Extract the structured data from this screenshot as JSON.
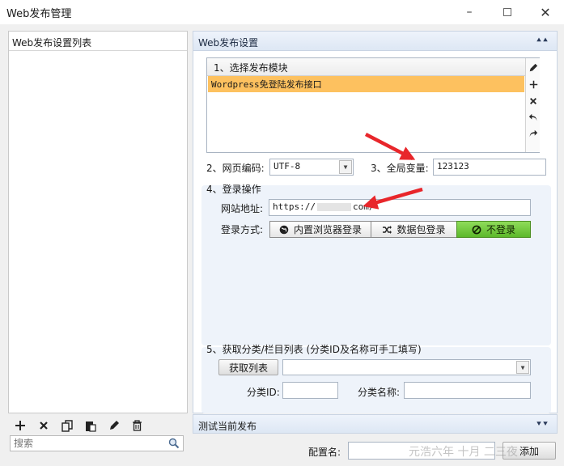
{
  "window": {
    "title": "Web发布管理",
    "minimize_icon": "minimize-icon",
    "maximize_icon": "maximize-icon",
    "close_icon": "close-icon"
  },
  "left_panel": {
    "header": "Web发布设置列表",
    "toolbar_icons": [
      "add-icon",
      "delete-icon",
      "copy-icon",
      "paste-icon",
      "edit-icon",
      "trash-icon"
    ],
    "search_placeholder": "搜索"
  },
  "right_panel": {
    "header": "Web发布设置",
    "module_section": {
      "label": "1、选择发布模块",
      "selected_item": "Wordpress免登陆发布接口",
      "tool_icons": [
        "edit-icon",
        "add-icon",
        "delete-icon",
        "undo-icon",
        "redo-icon"
      ]
    },
    "encoding": {
      "label": "2、网页编码:",
      "value": "UTF-8"
    },
    "global_var": {
      "label": "3、全局变量:",
      "value": "123123"
    },
    "login": {
      "label": "4、登录操作",
      "url_label": "网站地址:",
      "url_value_prefix": "https://",
      "url_value_suffix": "com/",
      "method_label": "登录方式:",
      "methods": [
        "内置浏览器登录",
        "数据包登录",
        "不登录"
      ],
      "active_method": "不登录"
    },
    "category": {
      "label": "5、获取分类/栏目列表 (分类ID及名称可手工填写)",
      "fetch_button": "获取列表",
      "id_label": "分类ID:",
      "name_label": "分类名称:"
    }
  },
  "test_section": {
    "header": "测试当前发布"
  },
  "footer": {
    "config_label": "配置名:",
    "add_button": "添加",
    "watermark": "元浩六年 十月 二三夜"
  },
  "colors": {
    "selected_row": "#fdc15f",
    "active_segment": "#5cb82a",
    "annotation_arrow": "#e8262b"
  }
}
